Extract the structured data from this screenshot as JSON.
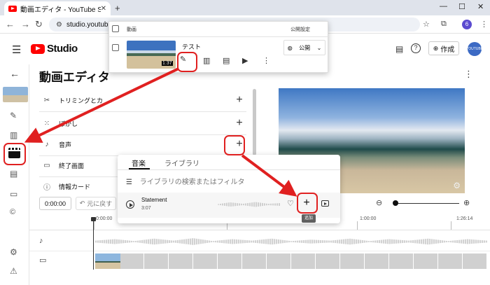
{
  "browser": {
    "tab_title": "動画エディタ - YouTube Studio",
    "tab_close": "✕",
    "new_tab": "+",
    "window_controls": [
      "⌄",
      "—",
      "☐",
      "✕"
    ],
    "url": "studio.youtube.co",
    "profile_initial": "6"
  },
  "studio": {
    "logo_text": "Studio",
    "create_label": "作成",
    "avatar_text": "YOUTUBE"
  },
  "page": {
    "title": "動画エディタ",
    "panel_rows": [
      {
        "label": "トリミングとカ",
        "icon": "scissors-icon"
      },
      {
        "label": "ぼかし",
        "icon": "blur-icon"
      },
      {
        "label": "音声",
        "icon": "music-note-icon"
      },
      {
        "label": "終了画面",
        "icon": "end-screen-icon"
      },
      {
        "label": "情報カード",
        "icon": "info-icon"
      }
    ]
  },
  "timeline": {
    "current_time": "0:00:00",
    "undo_label": "元に戻す",
    "ruler": [
      "0:00:00",
      "1:00:00",
      "1:26:14"
    ]
  },
  "library_popup": {
    "tabs": [
      "音楽",
      "ライブラリ"
    ],
    "search_placeholder": "ライブラリの検索またはフィルタ",
    "track": {
      "name": "Statement",
      "duration": "3:07"
    },
    "add_tooltip": "追加"
  },
  "content_popup": {
    "col_video": "動画",
    "col_visibility": "公開設定",
    "video_title": "テスト",
    "video_duration": "1:37",
    "visibility": "公開"
  },
  "colors": {
    "highlight": "#e02020",
    "brand": "#ff0000"
  }
}
